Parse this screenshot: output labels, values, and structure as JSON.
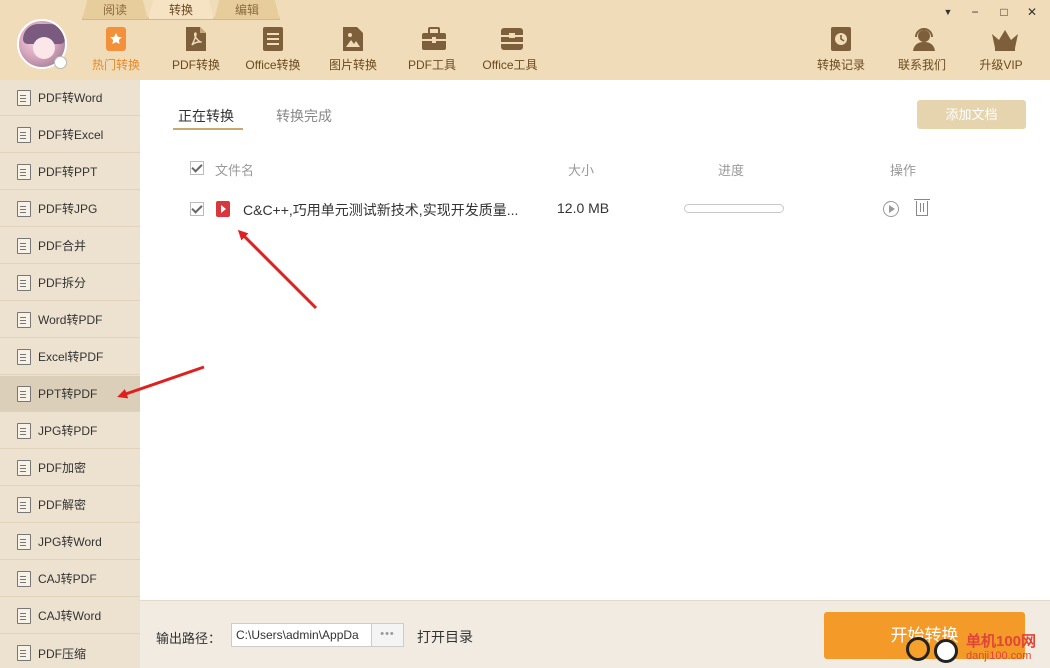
{
  "mode_tabs": [
    "阅读",
    "转换",
    "编辑"
  ],
  "tools": {
    "hot": "热门转换",
    "pdf_convert": "PDF转换",
    "office_convert": "Office转换",
    "image_convert": "图片转换",
    "pdf_tools": "PDF工具",
    "office_tools": "Office工具",
    "history": "转换记录",
    "contact": "联系我们",
    "vip": "升级VIP"
  },
  "window_controls": {
    "menu": "▼",
    "min": "−",
    "max": "□",
    "close": "✕"
  },
  "sidebar": {
    "items": [
      "PDF转Word",
      "PDF转Excel",
      "PDF转PPT",
      "PDF转JPG",
      "PDF合并",
      "PDF拆分",
      "Word转PDF",
      "Excel转PDF",
      "PPT转PDF",
      "JPG转PDF",
      "PDF加密",
      "PDF解密",
      "JPG转Word",
      "CAJ转PDF",
      "CAJ转Word",
      "PDF压缩"
    ],
    "selected": "PPT转PDF"
  },
  "main": {
    "tab_converting": "正在转换",
    "tab_done": "转换完成",
    "add_button": "添加文档",
    "headers": {
      "filename": "文件名",
      "size": "大小",
      "progress": "进度",
      "actions": "操作"
    },
    "files": [
      {
        "name": "C&C++,巧用单元测试新技术,实现开发质量...",
        "size": "12.0 MB",
        "progress": 0
      }
    ]
  },
  "footer": {
    "output_label": "输出路径：",
    "output_path": "C:\\Users\\admin\\AppDa",
    "browse": "•••",
    "open_dir": "打开目录",
    "start": "开始转换"
  },
  "watermark": {
    "name": "单机100网",
    "url": "danji100.com"
  },
  "colors": {
    "accent": "#f39a28",
    "topbar": "#f0dcb8",
    "sidebar": "#ede2d0",
    "arrow": "#e02020"
  }
}
